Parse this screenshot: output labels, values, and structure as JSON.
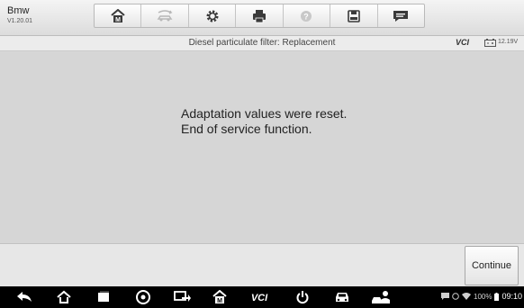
{
  "app": {
    "title": "Bmw",
    "version": "V1.20.01"
  },
  "toolbar": {
    "buttons": [
      {
        "name": "home-button",
        "icon": "home-icon"
      },
      {
        "name": "vehicle-swap-button",
        "icon": "car-swap-icon"
      },
      {
        "name": "settings-button",
        "icon": "gear-icon"
      },
      {
        "name": "print-button",
        "icon": "printer-icon"
      },
      {
        "name": "help-button",
        "icon": "help-icon"
      },
      {
        "name": "save-button",
        "icon": "save-icon"
      },
      {
        "name": "datalogging-button",
        "icon": "chat-icon"
      }
    ]
  },
  "header": {
    "title": "Diesel particulate filter: Replacement",
    "vci": "VCI",
    "battery_icon": "battery-icon",
    "voltage": "12.19V"
  },
  "message": {
    "line1": "Adaptation values were reset.",
    "line2": "End of service function."
  },
  "footer": {
    "continue_label": "Continue"
  },
  "navbar": {
    "items": [
      "back-icon",
      "home-icon",
      "recent-apps-icon",
      "chrome-icon",
      "remote-desk-icon",
      "garage-icon",
      "vci-icon",
      "power-icon",
      "car-icon",
      "workshop-icon"
    ],
    "vci_text": "VCI",
    "battery_percent": "100%",
    "time": "09:10"
  },
  "colors": {
    "toolbar_icon": "#3a3a3a",
    "toolbar_disabled": "#b8b8b8",
    "navbar": "#000000"
  }
}
